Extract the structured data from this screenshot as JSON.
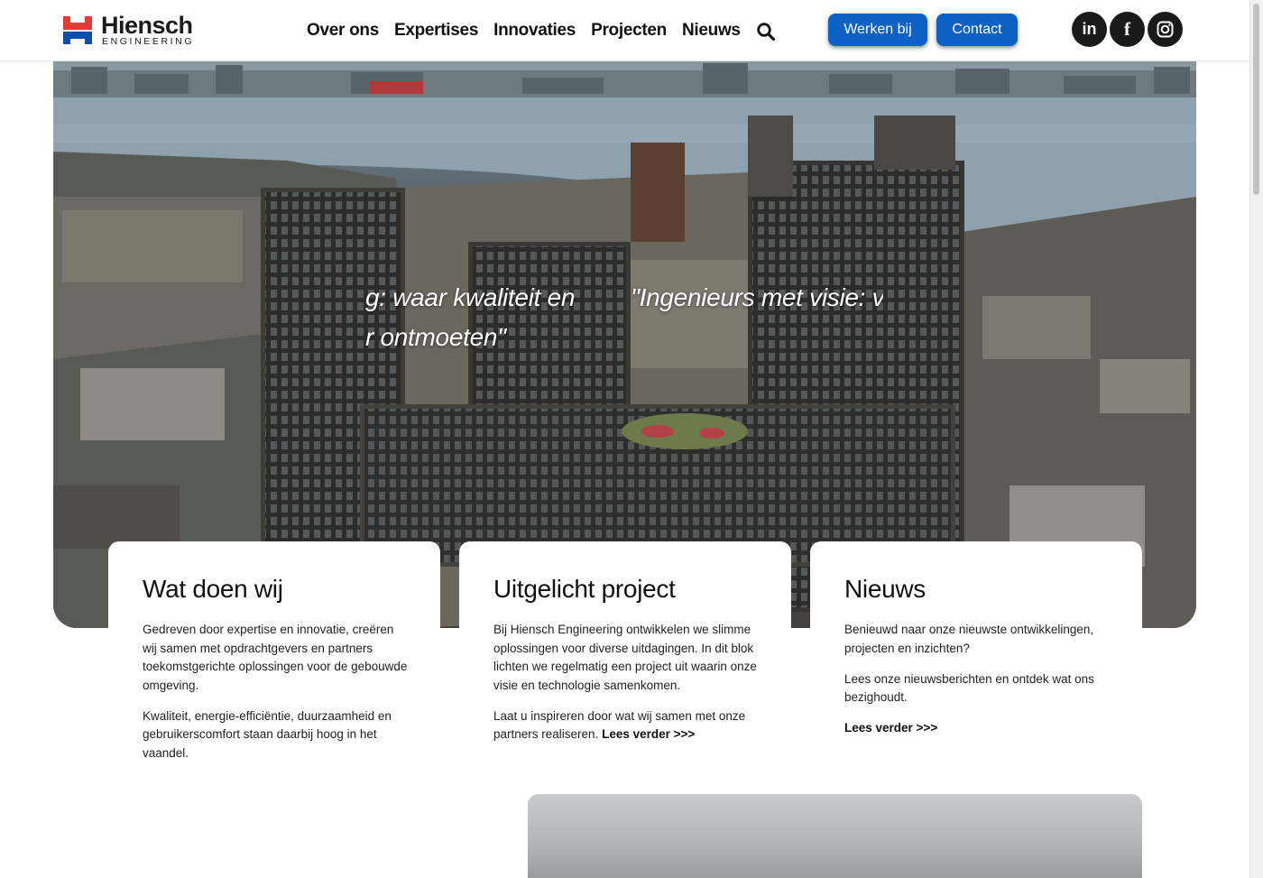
{
  "brand": {
    "name": "Hiensch",
    "subtitle": "ENGINEERING",
    "colors": {
      "red": "#e53935",
      "blue": "#0b4fa8",
      "button_blue": "#0b62c4"
    }
  },
  "nav": {
    "items": [
      "Over ons",
      "Expertises",
      "Innovaties",
      "Projecten",
      "Nieuws"
    ],
    "search_icon": "search-icon"
  },
  "header_buttons": {
    "werken": "Werken bij",
    "contact": "Contact"
  },
  "social": {
    "linkedin": "in",
    "facebook": "f",
    "instagram_icon": "instagram-icon"
  },
  "hero": {
    "slogan_left_line1": "g: waar kwaliteit en",
    "slogan_left_line2": "r ontmoeten\"",
    "slogan_right_line1": "\"Ingenieurs met visie: v"
  },
  "cards": [
    {
      "title": "Wat doen wij",
      "paragraphs": [
        "Gedreven door expertise en innovatie, creëren wij samen met opdrachtgevers en partners toekomstgerichte oplossingen voor de gebouwde omgeving.",
        "Kwaliteit, energie-efficiëntie, duurzaamheid en gebruikerscomfort staan daarbij hoog in het vaandel."
      ]
    },
    {
      "title": "Uitgelicht project",
      "paragraphs": [
        "Bij Hiensch Engineering ontwikkelen we slimme oplossingen voor diverse uitdagingen. In dit blok lichten we regelmatig een project uit waarin onze visie en technologie samenkomen.",
        "Laat u inspireren door wat wij samen met onze partners realiseren."
      ],
      "link": "Lees verder >>>"
    },
    {
      "title": "Nieuws",
      "paragraphs": [
        "Benieuwd naar onze nieuwste ontwikkelingen, projecten en inzichten?",
        "Lees onze nieuwsberichten en ontdek wat ons bezighoudt."
      ],
      "link": "Lees verder >>>"
    }
  ]
}
